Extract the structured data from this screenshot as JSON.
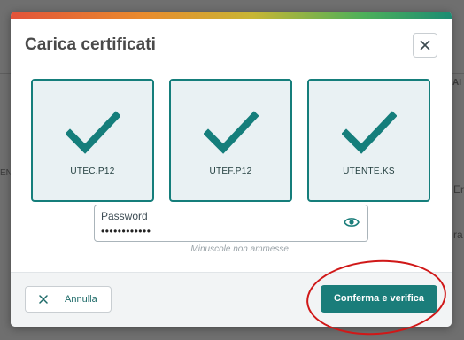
{
  "background": {
    "fragments": [
      "AI",
      "EN",
      "Er",
      "ra"
    ]
  },
  "modal": {
    "title": "Carica certificati",
    "close_icon": "close-icon",
    "certificates": [
      {
        "label": "UTEC.P12",
        "icon": "checkmark-icon"
      },
      {
        "label": "UTEF.P12",
        "icon": "checkmark-icon"
      },
      {
        "label": "UTENTE.KS",
        "icon": "checkmark-icon"
      }
    ],
    "password": {
      "label": "Password",
      "value": "••••••••••••",
      "hint": "Minuscole non ammesse",
      "toggle_icon": "eye-icon"
    },
    "footer": {
      "cancel_label": "Annulla",
      "cancel_icon": "close-icon",
      "confirm_label": "Conferma e verifica"
    }
  },
  "colors": {
    "accent": "#1a7d7a",
    "annotation": "#d01818"
  }
}
